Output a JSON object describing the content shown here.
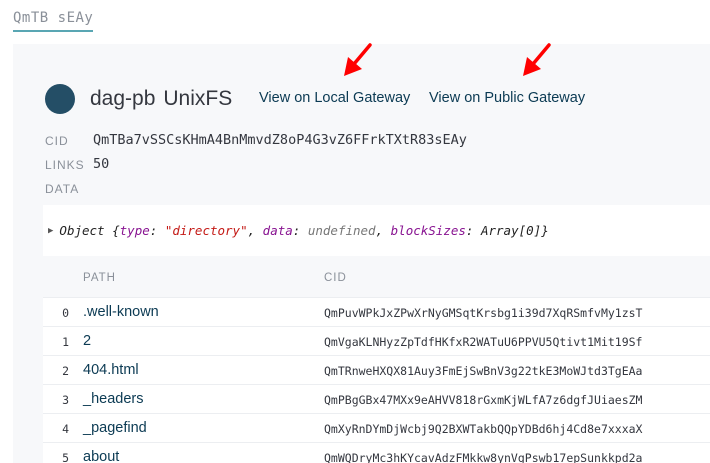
{
  "breadcrumb": "QmTB sEAy",
  "node": {
    "codec": "dag-pb",
    "format": "UnixFS",
    "local_gateway_label": "View on Local Gateway",
    "public_gateway_label": "View on Public Gateway"
  },
  "meta": {
    "cid_label": "CID",
    "cid_value": "QmTBa7vSSCsKHmA4BnMmvdZ8oP4G3vZ6FFrkTXtR83sEAy",
    "links_label": "LINKS",
    "links_value": "50",
    "data_label": "DATA"
  },
  "inspector": {
    "object_label": "Object",
    "open_brace": "{",
    "type_key": "type",
    "type_value": "\"directory\"",
    "data_key": "data",
    "data_value": "undefined",
    "blocksizes_key": "blockSizes",
    "blocksizes_value": "Array[0]",
    "close_brace": "}",
    "colon": ":",
    "comma": ","
  },
  "table": {
    "columns": {
      "path": "PATH",
      "cid": "CID"
    },
    "rows": [
      {
        "index": "0",
        "name": ".well-known",
        "cid": "QmPuvWPkJxZPwXrNyGMSqtKrsbg1i39d7XqRSmfvMy1zsT"
      },
      {
        "index": "1",
        "name": "2",
        "cid": "QmVgaKLNHyzZpTdfHKfxR2WATuU6PPVU5Qtivt1Mit19Sf"
      },
      {
        "index": "2",
        "name": "404.html",
        "cid": "QmTRnweHXQX81Auy3FmEjSwBnV3g22tkE3MoWJtd3TgEAa"
      },
      {
        "index": "3",
        "name": "_headers",
        "cid": "QmPBgGBx47MXx9eAHVV818rGxmKjWLfA7z6dgfJUiaesZM"
      },
      {
        "index": "4",
        "name": "_pagefind",
        "cid": "QmXyRnDYmDjWcbj9Q2BXWTakbQQpYDBd6hj4Cd8e7xxxaX"
      },
      {
        "index": "5",
        "name": "about",
        "cid": "QmWQDryMc3hKYcavAdzFMkkw8ynVgPswb17epSunkkpd2a"
      }
    ]
  },
  "colors": {
    "accent": "#59a6b3",
    "node_dot": "#244e66",
    "link": "#0b3a53",
    "annotation_arrow": "#ff0000"
  }
}
